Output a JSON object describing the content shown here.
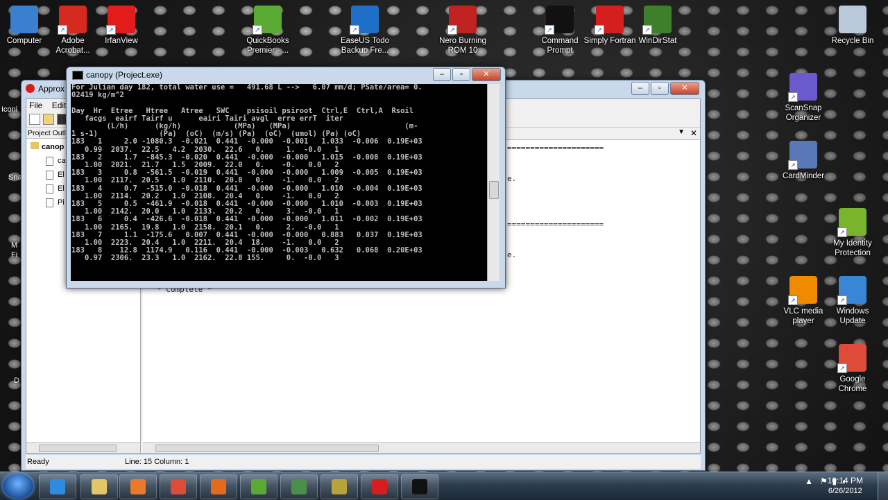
{
  "desktop_icons": [
    {
      "label": "Computer",
      "icon": "computer-icon",
      "color": "#3b7fd1"
    },
    {
      "label": "Adobe Acrobat...",
      "icon": "acrobat-icon",
      "color": "#d62a1e"
    },
    {
      "label": "IrfanView",
      "icon": "irfanview-icon",
      "color": "#e21b1b"
    },
    {
      "label": "QuickBooks Premier - ...",
      "icon": "quickbooks-icon",
      "color": "#5aa932"
    },
    {
      "label": "EaseUS Todo Backup Fre...",
      "icon": "easeus-icon",
      "color": "#1d6fc7"
    },
    {
      "label": "Nero Burning ROM 10",
      "icon": "nero-icon",
      "color": "#c0231f"
    },
    {
      "label": "Command Prompt",
      "icon": "cmd-icon",
      "color": "#111111"
    },
    {
      "label": "Simply Fortran",
      "icon": "fortran-icon",
      "color": "#d51f1f"
    },
    {
      "label": "WinDirStat",
      "icon": "windirstat-icon",
      "color": "#3d7f2a"
    },
    {
      "label": "Recycle Bin",
      "icon": "recycle-bin-icon",
      "color": "#b9c9d9"
    },
    {
      "label": "ScanSnap Organizer",
      "icon": "scansnap-icon",
      "color": "#6a5acd"
    },
    {
      "label": "CardMinder",
      "icon": "cardminder-icon",
      "color": "#5878b8"
    },
    {
      "label": "My Identity Protection",
      "icon": "identity-icon",
      "color": "#7ab42c"
    },
    {
      "label": "VLC media player",
      "icon": "vlc-icon",
      "color": "#f08a00"
    },
    {
      "label": "Windows Update",
      "icon": "windows-update-icon",
      "color": "#3a86d6"
    },
    {
      "label": "Google Chrome",
      "icon": "chrome-icon",
      "color": "#dd4b39"
    }
  ],
  "left_icon_labels": [
    "Iconi",
    "Sna",
    "M",
    "Fi",
    "D"
  ],
  "ide": {
    "title": "Approx",
    "menu": [
      "File",
      "Edit"
    ],
    "outline_header": "Project Outli",
    "tree_root": "canop",
    "tree_items": [
      "ca",
      "El",
      "El",
      "Pi"
    ],
    "editor_complete": "* Complete *",
    "editor_rule": "=====================",
    "editor_frag": "e.",
    "status_left": "Ready",
    "status_pos": "Line: 15 Column: 1",
    "controls": [
      "–",
      "▫",
      "✕"
    ]
  },
  "console": {
    "title": "canopy (Project.exe)",
    "controls": [
      "–",
      "▫",
      "✕"
    ],
    "lines": [
      "For Julian day 182, total water use =   491.68 L -->   6.07 mm/d; PSate/area= 0.",
      "02419 kg/m^2",
      "",
      "Day  Hr  Etree   Htree   Atree   SWC    psisoil psiroot  Ctrl,E  Ctrl,A  Rsoil",
      "   facgs  eairf Tairf u      eairi Tairi avgl  erre errT  iter",
      "        (L/h)      (kg/h)            (MPa)   (MPa)                          (m-",
      "1 s-1)              (Pa)  (oC)  (m/s) (Pa)  (oC)  (umol) (Pa) (oC)",
      "183   1     2.0 -1080.3  -0.021  0.441  -0.000  -0.001   1.033  -0.006  0.19E+03",
      "   0.99  2037.  22.5   4.2  2030.  22.6   0.     1.  -0.0   1",
      "183   2     1.7  -845.3  -0.020  0.441  -0.000  -0.000   1.015  -0.008  0.19E+03",
      "   1.00  2021.  21.7   1.5  2009.  22.0   0.    -0.   0.0   2",
      "183   3     0.8  -561.5  -0.019  0.441  -0.000  -0.000   1.009  -0.005  0.19E+03",
      "   1.00  2117.  20.5   1.0  2110.  20.8   0.    -1.   0.0   2",
      "183   4     0.7  -515.0  -0.018  0.441  -0.000  -0.000   1.010  -0.004  0.19E+03",
      "   1.00  2114.  20.2   1.0  2108.  20.4   0.    -1.   0.0   2",
      "183   5     0.5  -461.9  -0.018  0.441  -0.000  -0.000   1.010  -0.003  0.19E+03",
      "   1.00  2142.  20.0   1.0  2133.  20.2   0.     3.  -0.0   1",
      "183   6     0.4  -426.6  -0.018  0.441  -0.000  -0.000   1.011  -0.002  0.19E+03",
      "   1.00  2165.  19.8   1.0  2158.  20.1   0.     2.  -0.0   1",
      "183   7     1.1  -175.6   0.007  0.441  -0.000  -0.000   0.883   0.037  0.19E+03",
      "   1.00  2223.  20.4   1.0  2211.  20.4  18.    -1.   0.0   2",
      "183   8    12.8  1174.9   0.116  0.441  -0.000  -0.003   0.632   0.068  0.20E+03",
      "   0.97  2306.  23.3   1.0  2162.  22.8 155.     0.  -0.0   3"
    ]
  },
  "taskbar": {
    "apps": [
      {
        "name": "internet-explorer",
        "color": "#2f8be0"
      },
      {
        "name": "windows-explorer",
        "color": "#e3c56a"
      },
      {
        "name": "media-player",
        "color": "#e87a2a"
      },
      {
        "name": "chrome",
        "color": "#dd4b39"
      },
      {
        "name": "firefox",
        "color": "#e66a1c"
      },
      {
        "name": "quickbooks",
        "color": "#5aa932"
      },
      {
        "name": "project-app",
        "color": "#4a8f4a"
      },
      {
        "name": "chart-app",
        "color": "#b8a23a"
      },
      {
        "name": "simply-fortran",
        "color": "#d51f1f"
      },
      {
        "name": "command-prompt",
        "color": "#111111"
      }
    ],
    "time": "10:14 PM",
    "date": "6/26/2012"
  }
}
